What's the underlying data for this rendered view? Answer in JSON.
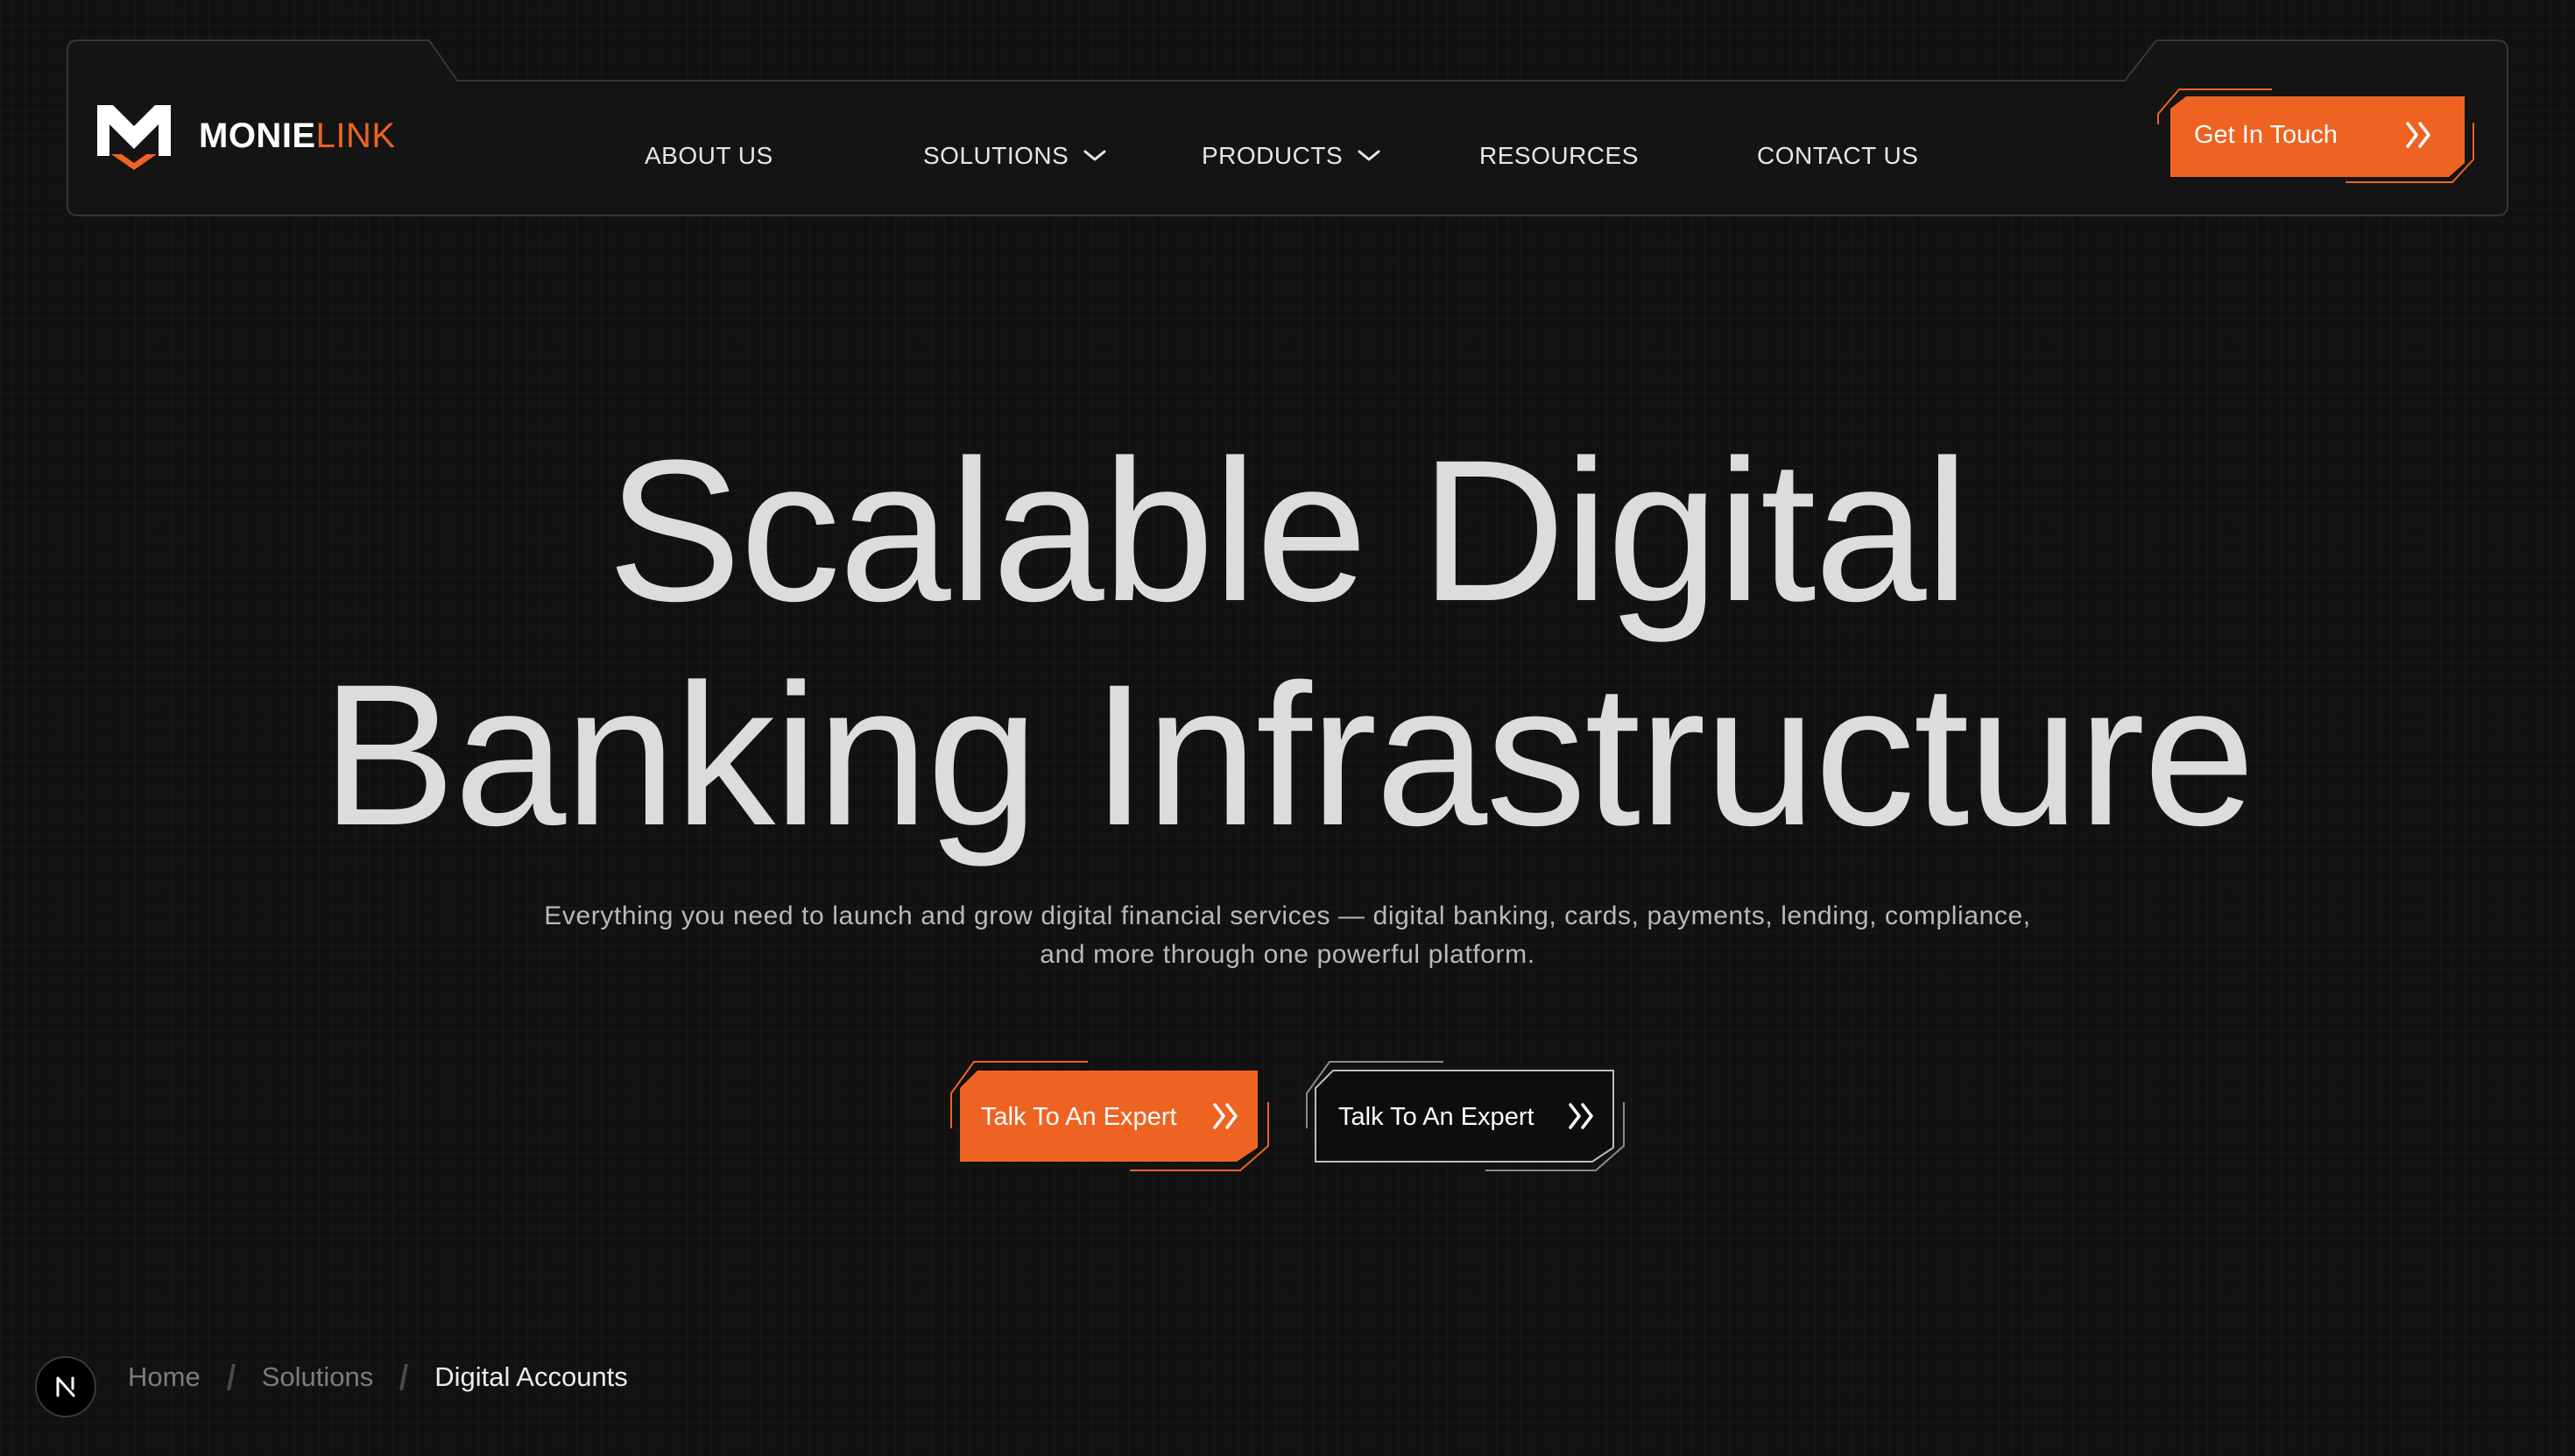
{
  "brand": {
    "name_primary": "MONIE",
    "name_accent": "LINK",
    "accent_color": "#ee6322",
    "logo_icon": "monielink-m-logo-icon"
  },
  "nav": {
    "items": [
      {
        "label": "ABOUT US",
        "has_dropdown": false
      },
      {
        "label": "SOLUTIONS",
        "has_dropdown": true,
        "icon": "chevron-down-icon"
      },
      {
        "label": "PRODUCTS",
        "has_dropdown": true,
        "icon": "chevron-down-icon"
      },
      {
        "label": "RESOURCES",
        "has_dropdown": false
      },
      {
        "label": "CONTACT US",
        "has_dropdown": false
      }
    ],
    "cta_label": "Get In Touch",
    "cta_icon": "double-chevron-right-icon"
  },
  "hero": {
    "title_line1": "Scalable Digital",
    "title_line2": "Banking Infrastructure",
    "subtitle": "Everything you need to launch and grow digital financial services — digital banking, cards, payments, lending, compliance, and more through one powerful platform.",
    "primary_cta": "Talk To An Expert",
    "secondary_cta": "Talk To An Expert"
  },
  "breadcrumb": {
    "items": [
      "Home",
      "Solutions"
    ],
    "current": "Digital Accounts",
    "separator_icon": "slash-separator-icon"
  },
  "floating_badge": {
    "icon": "n-logo-icon"
  },
  "colors": {
    "background": "#111111",
    "accent": "#ee6322",
    "text": "#dcdcdc",
    "muted": "#7c7c7c"
  }
}
